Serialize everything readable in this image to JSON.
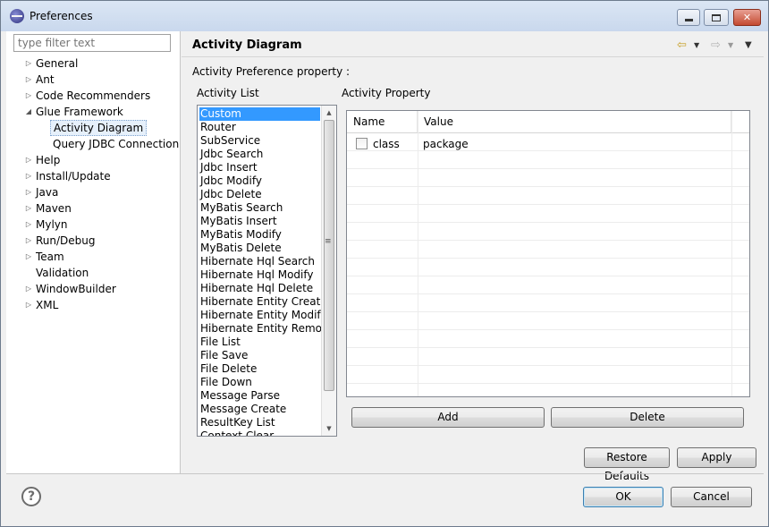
{
  "window": {
    "title": "Preferences",
    "minimize_label": "▭",
    "maximize_label": "□",
    "close_label": "✕"
  },
  "sidebar": {
    "filter_placeholder": "type filter text",
    "items": [
      {
        "label": "General",
        "expandable": true
      },
      {
        "label": "Ant",
        "expandable": true
      },
      {
        "label": "Code Recommenders",
        "expandable": true
      },
      {
        "label": "Glue Framework",
        "expandable": true,
        "expanded": true
      },
      {
        "label": "Activity Diagram",
        "child": true,
        "selected": true
      },
      {
        "label": "Query JDBC Connection",
        "child": true
      },
      {
        "label": "Help",
        "expandable": true
      },
      {
        "label": "Install/Update",
        "expandable": true
      },
      {
        "label": "Java",
        "expandable": true
      },
      {
        "label": "Maven",
        "expandable": true
      },
      {
        "label": "Mylyn",
        "expandable": true
      },
      {
        "label": "Run/Debug",
        "expandable": true
      },
      {
        "label": "Team",
        "expandable": true
      },
      {
        "label": "Validation",
        "expandable": false
      },
      {
        "label": "WindowBuilder",
        "expandable": true
      },
      {
        "label": "XML",
        "expandable": true
      }
    ]
  },
  "page": {
    "title": "Activity Diagram",
    "description": "Activity Preference property :",
    "activity_list_label": "Activity List",
    "activity_property_label": "Activity Property"
  },
  "activity_list": {
    "selected_index": 0,
    "items": [
      "Custom",
      "Router",
      "SubService",
      "Jdbc Search",
      "Jdbc Insert",
      "Jdbc Modify",
      "Jdbc Delete",
      "MyBatis Search",
      "MyBatis Insert",
      "MyBatis Modify",
      "MyBatis Delete",
      "Hibernate Hql Search",
      "Hibernate Hql Modify",
      "Hibernate Hql Delete",
      "Hibernate Entity Create",
      "Hibernate Entity Modify",
      "Hibernate Entity Remove",
      "File List",
      "File Save",
      "File Delete",
      "File Down",
      "Message Parse",
      "Message Create",
      "ResultKey List",
      "Context Clear"
    ]
  },
  "property_table": {
    "columns": [
      "Name",
      "Value"
    ],
    "rows": [
      {
        "checked": false,
        "name": "class",
        "value": "package"
      }
    ]
  },
  "buttons": {
    "add": "Add",
    "delete": "Delete",
    "restore_defaults": "Restore Defaults",
    "apply": "Apply",
    "ok": "OK",
    "cancel": "Cancel"
  },
  "icons": {
    "back": "arrow-left-icon",
    "forward": "arrow-right-icon",
    "menu": "chevron-down-icon",
    "help": "help-icon"
  }
}
